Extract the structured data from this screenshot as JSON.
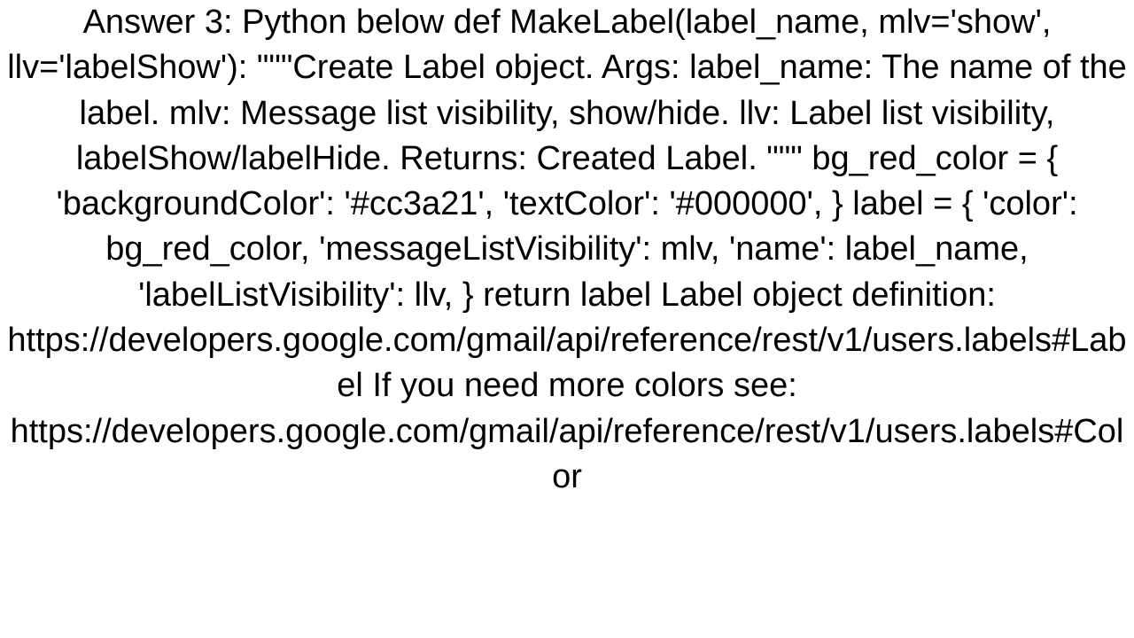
{
  "text": "Answer 3: Python below def MakeLabel(label_name, mlv='show', llv='labelShow'):     \"\"\"Create Label object.      Args:         label_name: The name of the label.         mlv: Message list visibility, show/hide.         llv: Label list visibility, labelShow/labelHide.      Returns:         Created Label.     \"\"\"     bg_red_color = {         'backgroundColor': '#cc3a21',         'textColor': '#000000',     }     label = {         'color':                 bg_red_color,         'messageListVisibility': mlv,         'name':                  label_name,         'labelListVisibility':   llv,     }     return label  Label object definition: https://developers.google.com/gmail/api/reference/rest/v1/users.labels#Label If you need more colors see: https://developers.google.com/gmail/api/reference/rest/v1/users.labels#Color"
}
